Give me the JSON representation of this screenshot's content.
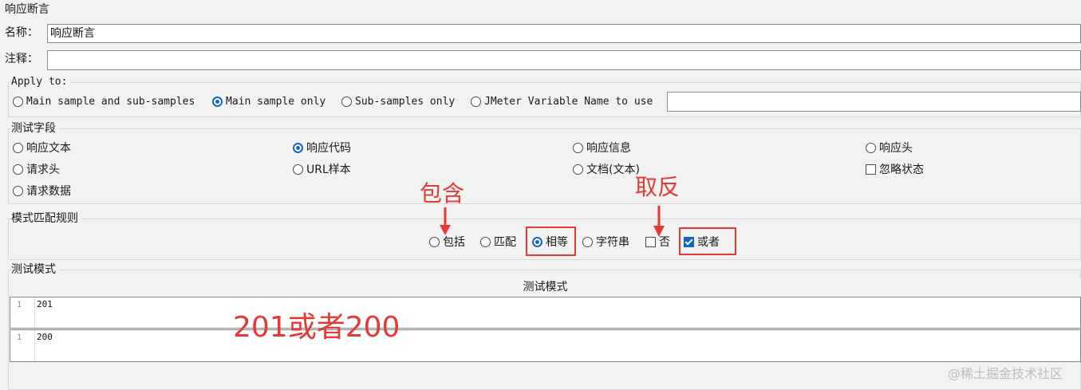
{
  "panel": {
    "title": "响应断言"
  },
  "name_field": {
    "label": "名称：",
    "value": "响应断言"
  },
  "comment_field": {
    "label": "注释：",
    "value": ""
  },
  "apply_to": {
    "legend": "Apply to:",
    "options": [
      {
        "label": "Main sample and sub-samples",
        "selected": false
      },
      {
        "label": "Main sample only",
        "selected": true
      },
      {
        "label": "Sub-samples only",
        "selected": false
      },
      {
        "label": "JMeter Variable Name to use",
        "selected": false
      }
    ],
    "variable_value": ""
  },
  "test_field": {
    "legend": "测试字段",
    "options": [
      {
        "label": "响应文本",
        "selected": false
      },
      {
        "label": "响应代码",
        "selected": true
      },
      {
        "label": "响应信息",
        "selected": false
      },
      {
        "label": "响应头",
        "selected": false
      },
      {
        "label": "请求头",
        "selected": false
      },
      {
        "label": "URL样本",
        "selected": false
      },
      {
        "label": "文档(文本)",
        "selected": false
      },
      {
        "label": "忽略状态",
        "checked": false
      },
      {
        "label": "请求数据",
        "selected": false
      }
    ]
  },
  "match_rules": {
    "legend": "模式匹配规则",
    "options": [
      {
        "label": "包括",
        "selected": false
      },
      {
        "label": "匹配",
        "selected": false
      },
      {
        "label": "相等",
        "selected": true
      },
      {
        "label": "字符串",
        "selected": false
      }
    ],
    "not_checkbox": {
      "label": "否",
      "checked": false
    },
    "or_checkbox": {
      "label": "或者",
      "checked": true
    }
  },
  "test_patterns": {
    "legend": "测试模式",
    "column_header": "测试模式",
    "rows": [
      {
        "line": "1",
        "value": "201"
      },
      {
        "line": "1",
        "value": "200"
      }
    ]
  },
  "annotations": {
    "contains": "包含",
    "invert": "取反",
    "example": "201或者200"
  },
  "watermark": "@稀土掘金技术社区",
  "colors": {
    "accent": "#1565c0",
    "annotation": "#e53935"
  }
}
